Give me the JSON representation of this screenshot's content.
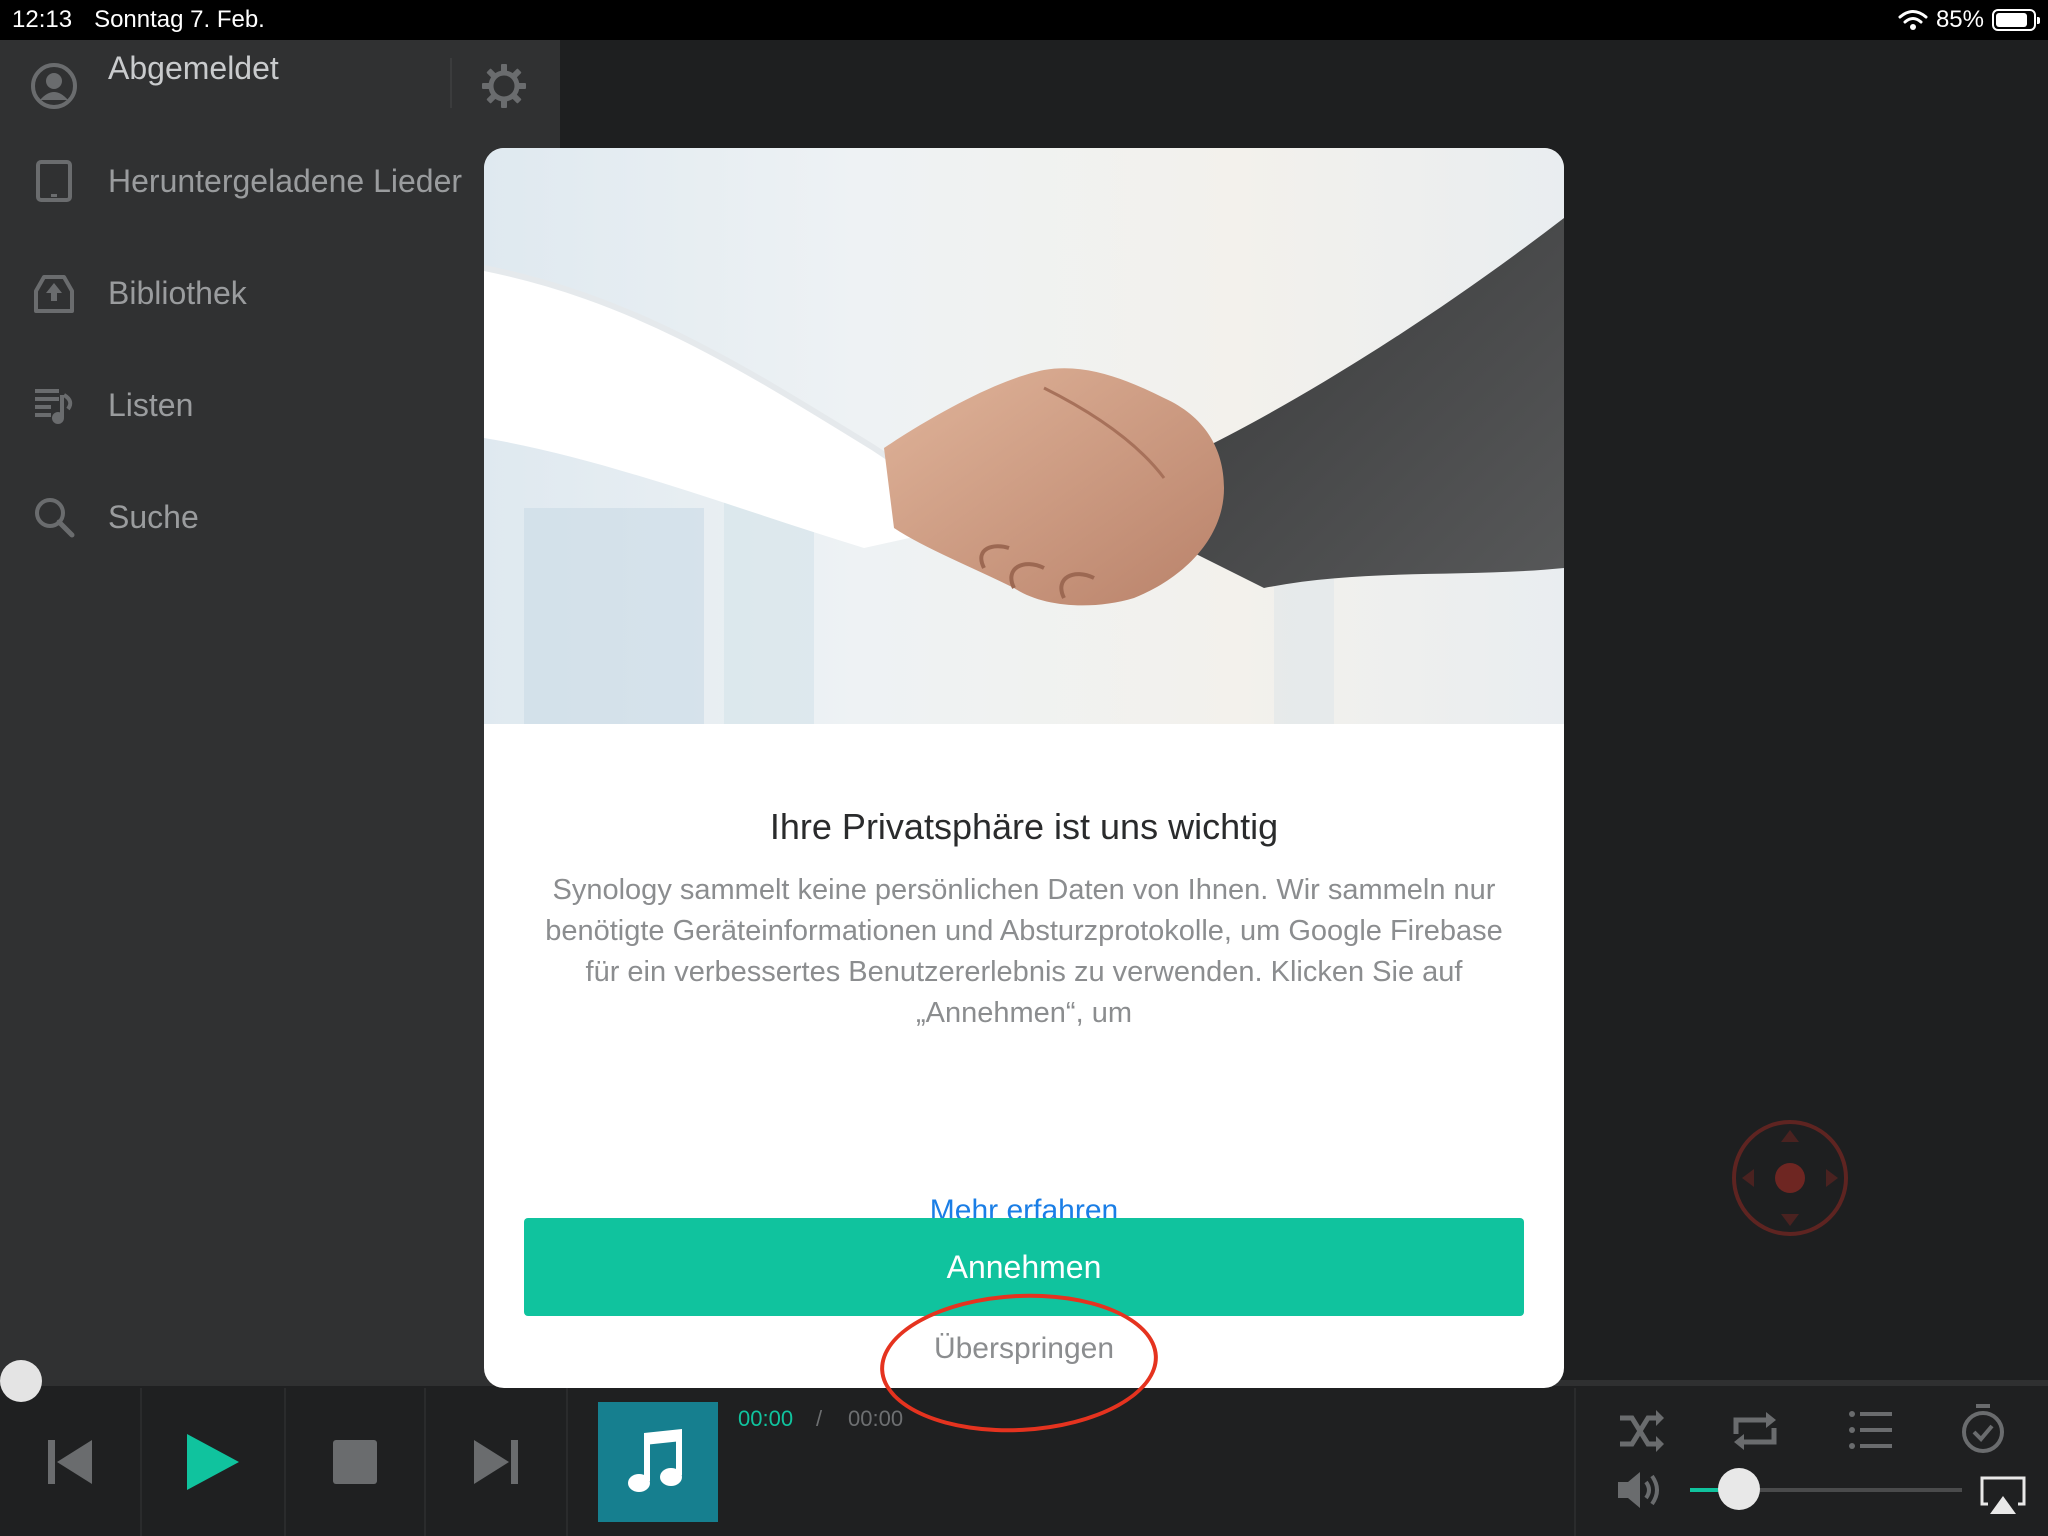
{
  "status_bar": {
    "time": "12:13",
    "date": "Sonntag 7. Feb.",
    "battery": "85%",
    "battery_level": 0.85
  },
  "sidebar": {
    "user_label": "Abgemeldet",
    "items": [
      {
        "label": "Heruntergeladene Lieder",
        "icon": "tablet-icon"
      },
      {
        "label": "Bibliothek",
        "icon": "library-icon"
      },
      {
        "label": "Listen",
        "icon": "playlist-icon"
      },
      {
        "label": "Suche",
        "icon": "search-icon"
      }
    ]
  },
  "player": {
    "current_time": "00:00",
    "separator": "/",
    "total_time": "00:00",
    "progress": 0,
    "volume": 0.18,
    "accent_color": "#10c39e"
  },
  "modal": {
    "title": "Ihre Privatsphäre ist uns wichtig",
    "body": "Synology sammelt keine persönlichen Daten von Ihnen. Wir sammeln nur benötigte Geräteinformationen und Absturzprotokolle, um Google Firebase für ein verbessertes Benutzererlebnis zu verwenden. Klicken Sie auf „Annehmen“, um",
    "link": "Mehr erfahren",
    "accept_label": "Annehmen",
    "skip_label": "Überspringen",
    "accent_color": "#10c39e",
    "link_color": "#1a7ee6",
    "annotation_color": "#e5331f"
  }
}
